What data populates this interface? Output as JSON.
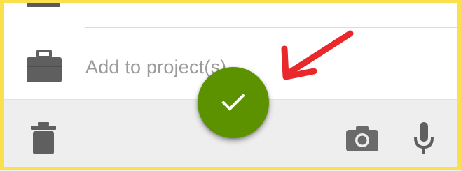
{
  "project_field": {
    "placeholder": "Add to project(s)",
    "icon": "briefcase-icon"
  },
  "fab": {
    "icon": "check-icon",
    "color": "#5C9200"
  },
  "bottom_bar": {
    "background": "#EEEEEE",
    "icons": [
      "trash-icon",
      "camera-icon",
      "mic-icon"
    ]
  },
  "annotation": {
    "icon": "red-arrow",
    "color": "#E8282B"
  },
  "frame": {
    "color": "#FBE04D"
  }
}
